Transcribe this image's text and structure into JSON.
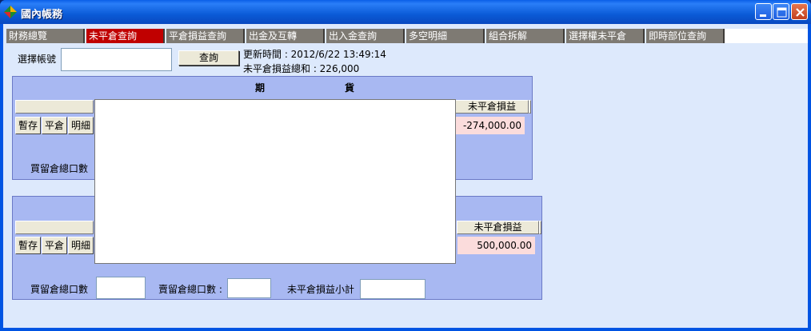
{
  "window": {
    "title": "國內帳務"
  },
  "tabs": [
    {
      "label": "財務總覽"
    },
    {
      "label": "未平倉查詢"
    },
    {
      "label": "平倉損益查詢"
    },
    {
      "label": "出金及互轉"
    },
    {
      "label": "出入金查詢"
    },
    {
      "label": "多空明細"
    },
    {
      "label": "組合拆解"
    },
    {
      "label": "選擇權未平倉"
    },
    {
      "label": "即時部位查詢"
    }
  ],
  "toolbar": {
    "account_label": "選擇帳號",
    "account_value": "",
    "query_button": "查詢",
    "update_time": "更新時間 : 2012/6/22 13:49:14",
    "total_unrealized": "未平倉損益總和 : 226,000"
  },
  "futures_panel": {
    "title_left": "期",
    "title_right": "貨",
    "pl_header": "未平倉損益",
    "pl_value": "-274,000.00",
    "btn_temp": "暫存",
    "btn_close": "平倉",
    "btn_detail": "明細",
    "buy_total_label": "買留倉總口數"
  },
  "options_panel": {
    "pl_header": "未平倉損益",
    "pl_value": "500,000.00",
    "btn_temp": "暫存",
    "btn_close": "平倉",
    "btn_detail": "明細",
    "buy_total_label": "買留倉總口數",
    "buy_total_value": "",
    "sell_total_label": "賣留倉總口數 :",
    "sell_total_value": "",
    "subtotal_label": "未平倉損益小計",
    "subtotal_value": ""
  },
  "colors": {
    "active_tab": "#c00000",
    "tab": "#7e7a73",
    "panel": "#a8b8f2",
    "loss_cell": "#fbdcdc"
  }
}
